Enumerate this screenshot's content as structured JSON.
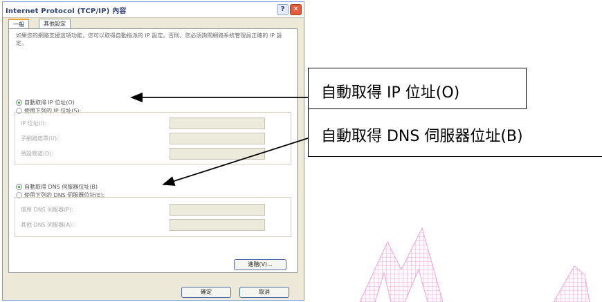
{
  "dialog": {
    "title": "Internet Protocol (TCP/IP) 內容",
    "help_button": "?",
    "close_button": "✕",
    "tabs": [
      {
        "label": "一般"
      },
      {
        "label": "其他設定"
      }
    ],
    "description": "如果您的網路支援這項功能，您可以取得自動指派的 IP 設定。否則，您必須詢問網路系統管理員正確的 IP 設定。",
    "ip": {
      "auto_radio": "自動取得 IP 位址(O)",
      "manual_radio": "使用下列的 IP 位址(S):",
      "fields": [
        {
          "label": "IP 位址(I):"
        },
        {
          "label": "子網路遮罩(U):"
        },
        {
          "label": "預設閘道(D):"
        }
      ]
    },
    "dns": {
      "auto_radio": "自動取得 DNS 伺服器位址(B)",
      "manual_radio": "使用下列的 DNS 伺服器位址(E):",
      "fields": [
        {
          "label": "慣用 DNS 伺服器(P):"
        },
        {
          "label": "其他 DNS 伺服器(A):"
        }
      ]
    },
    "advanced_button": "進階(V)...",
    "ok_button": "確定",
    "cancel_button": "取消"
  },
  "callouts": {
    "auto_ip": "自動取得 IP 位址(O)",
    "auto_dns": "自動取得 DNS 伺服器位址(B)"
  },
  "colors": {
    "radio_selected": "#27a335",
    "watermark": "#f080c8"
  }
}
